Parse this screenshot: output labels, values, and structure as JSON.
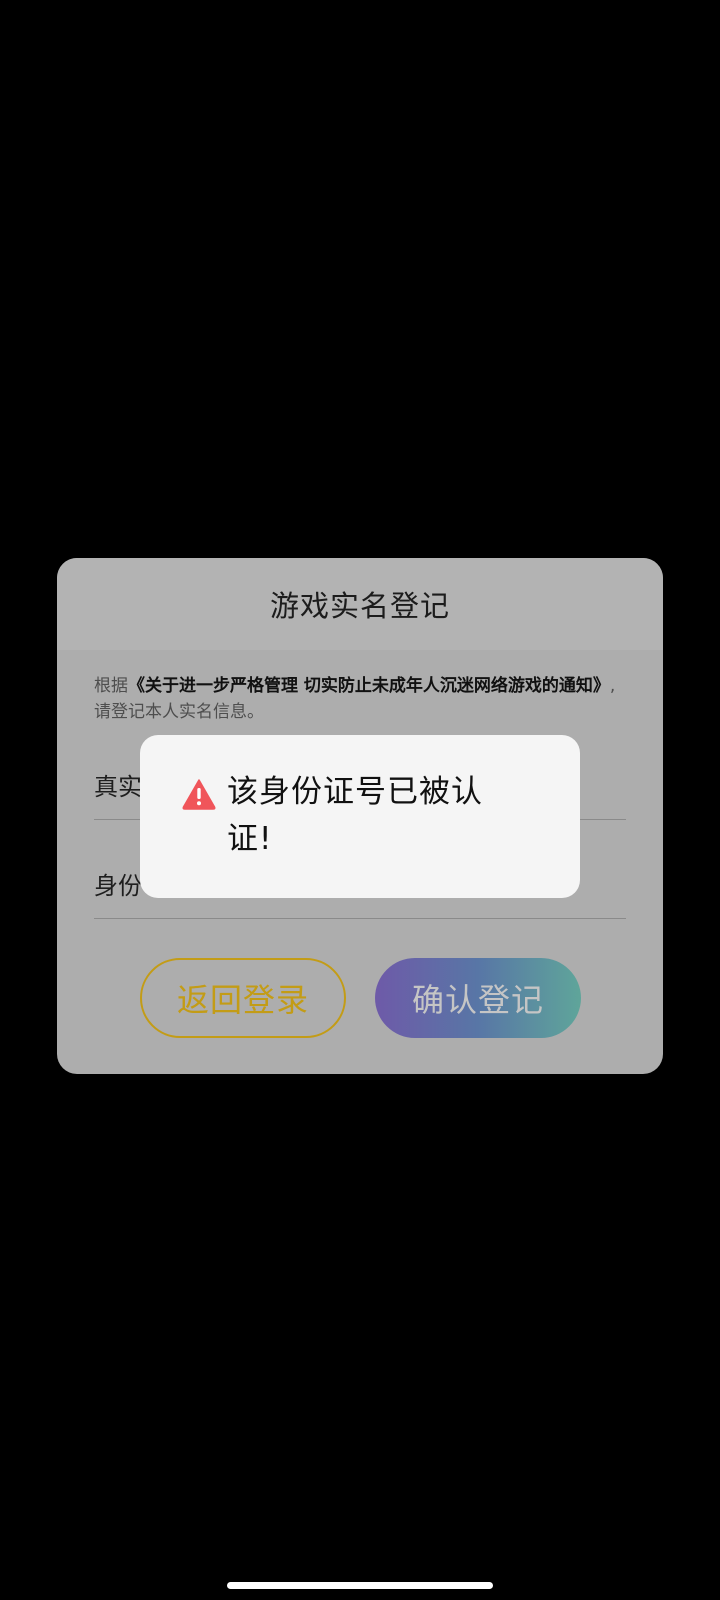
{
  "dialog": {
    "title": "游戏实名登记",
    "notice_prefix": "根据",
    "notice_doc": "《关于进一步严格管理 切实防止未成年人沉迷网络游戏的通知》",
    "notice_suffix": ",请登记本人实名信息。",
    "fields": {
      "name_label": "真实",
      "id_label": "身份"
    },
    "buttons": {
      "back": "返回登录",
      "confirm": "确认登记"
    }
  },
  "toast": {
    "icon": "warning-icon",
    "message": "该身份证号已被认证!"
  },
  "colors": {
    "background": "#000000",
    "dialog": "#adadad",
    "back_button": "#c39c16",
    "warning": "#f0555a"
  }
}
